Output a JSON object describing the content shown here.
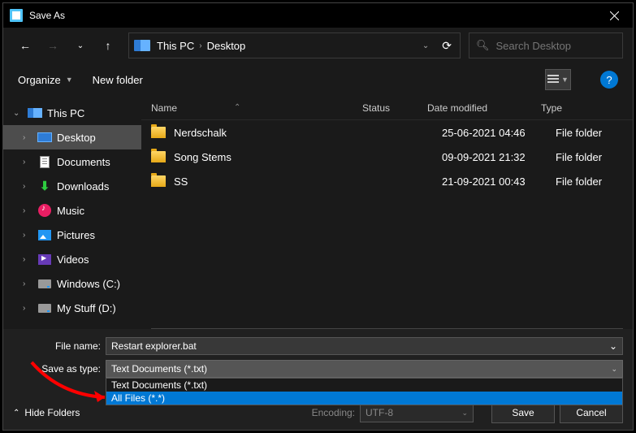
{
  "titlebar": {
    "title": "Save As"
  },
  "breadcrumb": {
    "root": "This PC",
    "current": "Desktop"
  },
  "search": {
    "placeholder": "Search Desktop"
  },
  "toolbar": {
    "organize": "Organize",
    "newfolder": "New folder"
  },
  "sidebar": {
    "items": [
      {
        "label": "This PC",
        "icon": "pc",
        "chev": "⌄",
        "level": 1
      },
      {
        "label": "Desktop",
        "icon": "desktop",
        "chev": "›",
        "level": 2,
        "active": true
      },
      {
        "label": "Documents",
        "icon": "doc",
        "chev": "›",
        "level": 2
      },
      {
        "label": "Downloads",
        "icon": "dl",
        "chev": "›",
        "level": 2
      },
      {
        "label": "Music",
        "icon": "music",
        "chev": "›",
        "level": 2
      },
      {
        "label": "Pictures",
        "icon": "pic",
        "chev": "›",
        "level": 2
      },
      {
        "label": "Videos",
        "icon": "vid",
        "chev": "›",
        "level": 2
      },
      {
        "label": "Windows (C:)",
        "icon": "drive",
        "chev": "›",
        "level": 2
      },
      {
        "label": "My Stuff (D:)",
        "icon": "drive",
        "chev": "›",
        "level": 2
      }
    ]
  },
  "columns": {
    "name": "Name",
    "status": "Status",
    "date": "Date modified",
    "type": "Type"
  },
  "rows": [
    {
      "name": "Nerdschalk",
      "date": "25-06-2021 04:46",
      "type": "File folder"
    },
    {
      "name": "Song Stems",
      "date": "09-09-2021 21:32",
      "type": "File folder"
    },
    {
      "name": "SS",
      "date": "21-09-2021 00:43",
      "type": "File folder"
    }
  ],
  "footer": {
    "filename_label": "File name:",
    "filename_value": "Restart explorer.bat",
    "savetype_label": "Save as type:",
    "savetype_value": "Text Documents (*.txt)",
    "options": [
      {
        "label": "Text Documents (*.txt)",
        "hl": false
      },
      {
        "label": "All Files  (*.*)",
        "hl": true
      }
    ],
    "hide_folders": "Hide Folders",
    "encoding_label": "Encoding:",
    "encoding_value": "UTF-8",
    "save": "Save",
    "cancel": "Cancel"
  }
}
